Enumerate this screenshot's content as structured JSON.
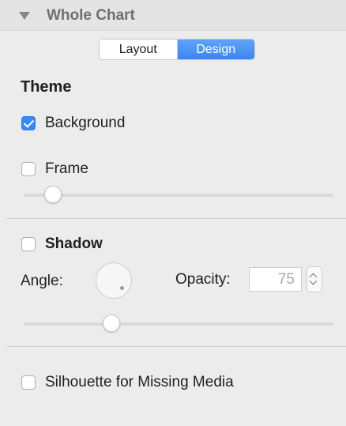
{
  "header": {
    "title": "Whole Chart"
  },
  "tabs": {
    "layout": "Layout",
    "design": "Design",
    "selected": "Design"
  },
  "theme": {
    "title": "Theme",
    "background": {
      "label": "Background",
      "checked": true
    },
    "frame": {
      "label": "Frame",
      "checked": false,
      "slider_value": 0.07
    }
  },
  "shadow": {
    "label": "Shadow",
    "checked": false,
    "angle_label": "Angle:",
    "opacity_label": "Opacity:",
    "opacity_value": "75",
    "slider_value": 0.27
  },
  "missing_media": {
    "label": "Silhouette for Missing Media",
    "checked": false
  },
  "colors": {
    "accent": "#3a88f4",
    "header_text": "#6f6f6f",
    "panel_bg": "#ececec"
  }
}
